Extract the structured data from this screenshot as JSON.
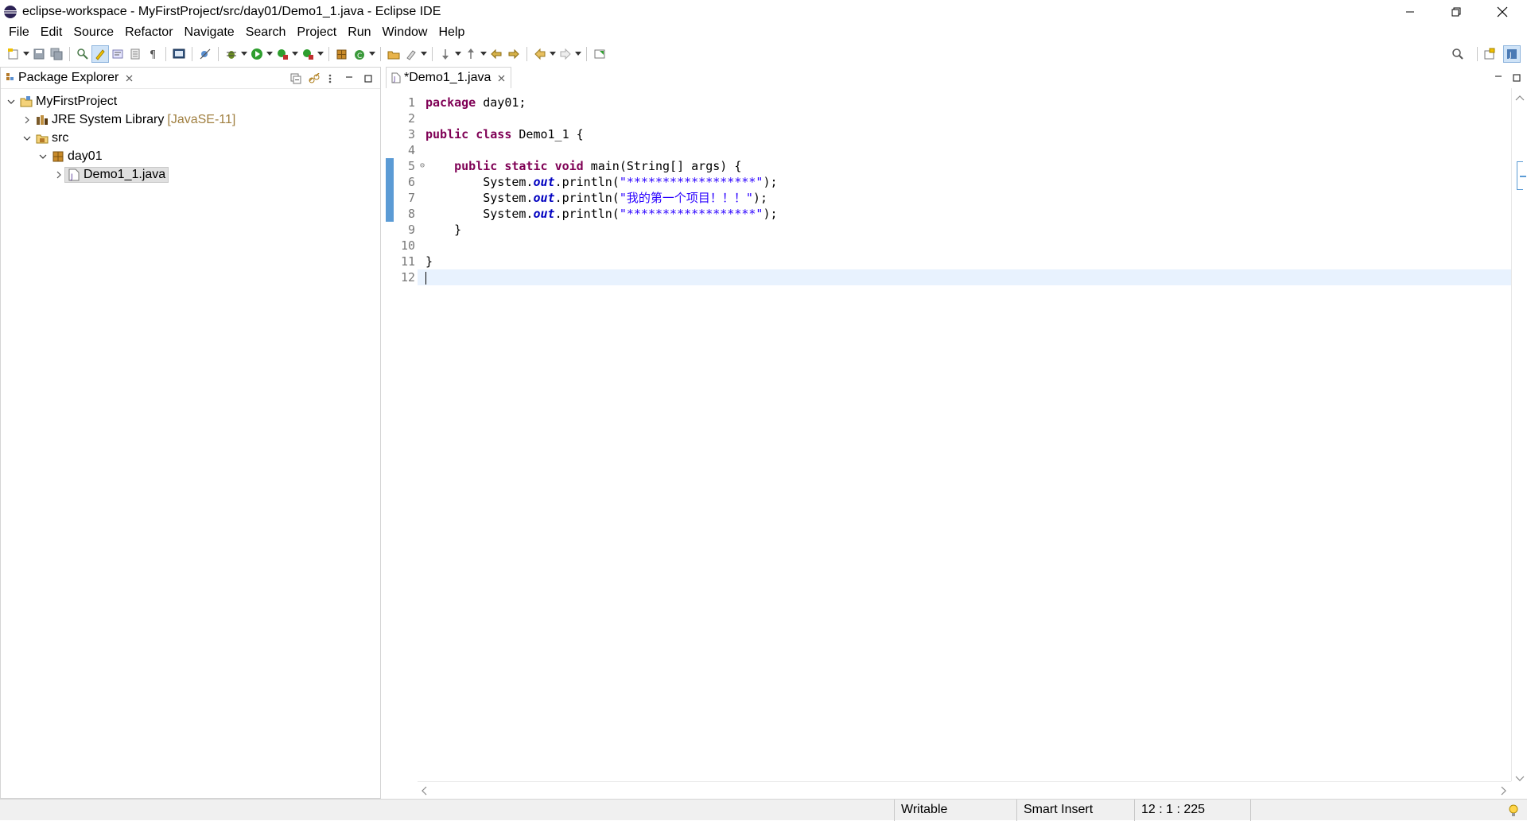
{
  "window": {
    "title": "eclipse-workspace - MyFirstProject/src/day01/Demo1_1.java - Eclipse IDE",
    "app_icon": "eclipse-icon",
    "controls": [
      "minimize-icon",
      "restore-icon",
      "close-icon"
    ]
  },
  "menubar": {
    "items": [
      "File",
      "Edit",
      "Source",
      "Refactor",
      "Navigate",
      "Search",
      "Project",
      "Run",
      "Window",
      "Help"
    ]
  },
  "toolbar": {
    "buttons": [
      "new-icon",
      "save-icon",
      "save-all-icon",
      "open-type-icon",
      "mark-occurrences-icon",
      "block-selection-icon",
      "toggle-breadcrumb-icon",
      "show-whitespace-icon",
      "terminal-icon",
      "skip-breakpoints-icon",
      "debug-icon",
      "run-icon",
      "coverage-icon",
      "external-tools-icon",
      "new-java-package-icon",
      "new-java-class-icon",
      "open-type-dialog-icon",
      "search-toolbar-icon",
      "next-annotation-icon",
      "previous-annotation-icon",
      "last-edit-icon",
      "back-icon",
      "forward-icon",
      "pin-editor-icon"
    ],
    "right_buttons": [
      "quick-access-search-icon",
      "open-perspective-icon",
      "java-perspective-icon"
    ]
  },
  "package_explorer": {
    "tab_label": "Package Explorer",
    "tree": [
      {
        "label": "MyFirstProject",
        "qualifier": "",
        "level": 0,
        "expanded": true,
        "icon": "java-project-icon"
      },
      {
        "label": "JRE System Library",
        "qualifier": "[JavaSE-11]",
        "level": 1,
        "expanded": false,
        "icon": "library-icon"
      },
      {
        "label": "src",
        "qualifier": "",
        "level": 1,
        "expanded": true,
        "icon": "source-folder-icon"
      },
      {
        "label": "day01",
        "qualifier": "",
        "level": 2,
        "expanded": true,
        "icon": "package-icon"
      },
      {
        "label": "Demo1_1.java",
        "qualifier": "",
        "level": 3,
        "expanded": false,
        "icon": "java-file-icon",
        "selected": true
      }
    ]
  },
  "editor": {
    "tab_label": "*Demo1_1.java",
    "line_numbers": [
      "1",
      "2",
      "3",
      "4",
      "5",
      "6",
      "7",
      "8",
      "9",
      "10",
      "11",
      "12"
    ],
    "lines": [
      [
        {
          "t": "package",
          "c": "kw"
        },
        {
          "t": " day01;",
          "c": ""
        }
      ],
      [],
      [
        {
          "t": "public",
          "c": "kw"
        },
        {
          "t": " ",
          "c": ""
        },
        {
          "t": "class",
          "c": "kw"
        },
        {
          "t": " Demo1_1 {",
          "c": ""
        }
      ],
      [],
      [
        {
          "t": "    ",
          "c": ""
        },
        {
          "t": "public",
          "c": "kw"
        },
        {
          "t": " ",
          "c": ""
        },
        {
          "t": "static",
          "c": "kw"
        },
        {
          "t": " ",
          "c": ""
        },
        {
          "t": "void",
          "c": "kw"
        },
        {
          "t": " main(String[] args) {",
          "c": ""
        }
      ],
      [
        {
          "t": "        System.",
          "c": ""
        },
        {
          "t": "out",
          "c": "fld"
        },
        {
          "t": ".println(",
          "c": ""
        },
        {
          "t": "\"******************\"",
          "c": "str"
        },
        {
          "t": ");",
          "c": ""
        }
      ],
      [
        {
          "t": "        System.",
          "c": ""
        },
        {
          "t": "out",
          "c": "fld"
        },
        {
          "t": ".println(",
          "c": ""
        },
        {
          "t": "\"我的第一个项目！！！\"",
          "c": "str"
        },
        {
          "t": ");",
          "c": ""
        }
      ],
      [
        {
          "t": "        System.",
          "c": ""
        },
        {
          "t": "out",
          "c": "fld"
        },
        {
          "t": ".println(",
          "c": ""
        },
        {
          "t": "\"******************\"",
          "c": "str"
        },
        {
          "t": ");",
          "c": ""
        }
      ],
      [
        {
          "t": "    }",
          "c": ""
        }
      ],
      [],
      [
        {
          "t": "}",
          "c": ""
        }
      ],
      []
    ],
    "current_line": 12,
    "fold_marker_line": 5,
    "warning_marker_line": 7
  },
  "statusbar": {
    "writable": "Writable",
    "insert_mode": "Smart Insert",
    "position": "12 : 1 : 225",
    "tip_icon": "lightbulb-icon"
  },
  "colors": {
    "keyword": "#7f0055",
    "string": "#2a00ff",
    "field": "#0000c0",
    "current_line": "#e8f2fe",
    "change_ruler": "#5b9bd5"
  }
}
